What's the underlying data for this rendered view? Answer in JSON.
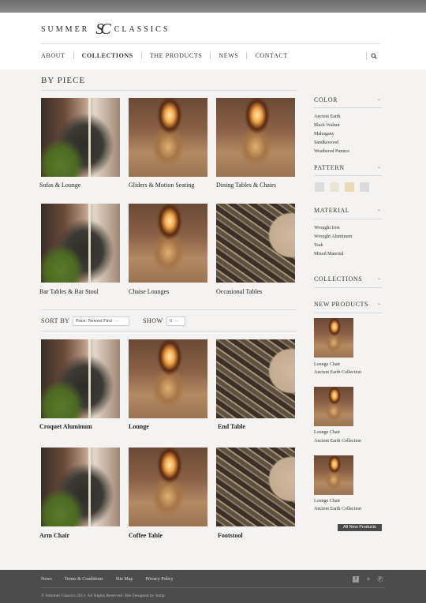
{
  "brand": {
    "left": "SUMMER",
    "monogram": "SC",
    "right": "CLASSICS"
  },
  "nav": [
    "ABOUT",
    "COLLECTIONS",
    "THE PRODUCTS",
    "NEWS",
    "CONTACT"
  ],
  "page_title": "BY PIECE",
  "categories": [
    "Sofas & Lounge",
    "Gliders & Motion Seating",
    "Dining Tables & Chairs",
    "Bar Tables & Bar Stool",
    "Chaise Lounges",
    "Occasional Tables"
  ],
  "sort": {
    "label": "SORT BY",
    "value": "Price: Newest First",
    "show_label": "SHOW",
    "show_value": "6"
  },
  "products": [
    "Croquet Aluminum",
    "Lounge",
    "End Table",
    "Arm Chair",
    "Coffee Table",
    "Footstool"
  ],
  "sidebar": {
    "color": {
      "title": "COLOR",
      "options": [
        "Ancient Earth",
        "Black Walnut",
        "Mahogany",
        "Sandkewood",
        "Weathered Pumice"
      ]
    },
    "pattern": {
      "title": "PATTERN",
      "swatches": [
        "#dcdcdc",
        "#ebe5d4",
        "#e9d9b4",
        "#d9dbdc"
      ]
    },
    "material": {
      "title": "MATERIAL",
      "options": [
        "Wrought Iron",
        "Wrought Aluminum",
        "Teak",
        "Mixed Material"
      ]
    },
    "collections": {
      "title": "COLLECTIONS"
    },
    "new_products": {
      "title": "NEW PRODUCTS",
      "items": [
        {
          "name": "Lounge Chair",
          "collection": "Ancient Earth Collection"
        },
        {
          "name": "Lounge Chair",
          "collection": "Ancient Earth Collection"
        },
        {
          "name": "Lounge Chair",
          "collection": "Ancient Earth Collection"
        }
      ],
      "button": "All New Products"
    }
  },
  "footer": {
    "links": [
      "News",
      "Terms & Conditions",
      "Site Map",
      "Privacy Policy"
    ],
    "copyright": "© Summer Classics 2013. All Rights Reserved. Site Designed by Jump"
  }
}
